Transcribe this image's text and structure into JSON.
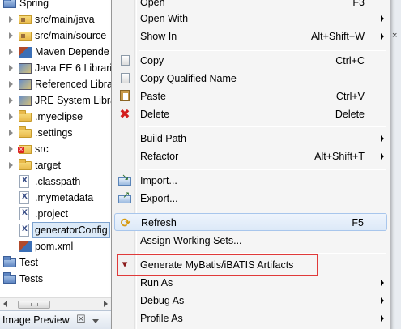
{
  "explorer": {
    "items": [
      {
        "label": "Spring",
        "icon": "project-icon"
      },
      {
        "label": "src/main/java",
        "icon": "package-folder-icon"
      },
      {
        "label": "src/main/source",
        "icon": "package-folder-icon"
      },
      {
        "label": "Maven Depende",
        "icon": "maven-library-icon"
      },
      {
        "label": "Java EE 6 Librari",
        "icon": "library-icon"
      },
      {
        "label": "Referenced Libra",
        "icon": "library-icon"
      },
      {
        "label": "JRE System Libra",
        "icon": "library-icon"
      },
      {
        "label": ".myeclipse",
        "icon": "folder-icon"
      },
      {
        "label": ".settings",
        "icon": "folder-icon"
      },
      {
        "label": "src",
        "icon": "error-folder-icon"
      },
      {
        "label": "target",
        "icon": "folder-icon"
      },
      {
        "label": ".classpath",
        "icon": "xml-file-icon"
      },
      {
        "label": ".mymetadata",
        "icon": "xml-file-icon"
      },
      {
        "label": ".project",
        "icon": "xml-file-icon"
      },
      {
        "label": "generatorConfig",
        "icon": "xml-file-icon",
        "selected": true
      },
      {
        "label": "pom.xml",
        "icon": "maven-pom-icon"
      },
      {
        "label": "Test",
        "icon": "project-icon"
      },
      {
        "label": "Tests",
        "icon": "project-icon"
      }
    ]
  },
  "bottom_tab": {
    "label": "Image Preview",
    "close": "☒"
  },
  "context_menu": {
    "items": [
      {
        "label": "Open",
        "accel": "F3"
      },
      {
        "label": "Open With",
        "submenu": true
      },
      {
        "label": "Show In",
        "accel": "Alt+Shift+W",
        "submenu": true
      },
      {
        "separator": true
      },
      {
        "label": "Copy",
        "accel": "Ctrl+C",
        "icon": "copy-icon"
      },
      {
        "label": "Copy Qualified Name",
        "icon": "copy-qualified-icon"
      },
      {
        "label": "Paste",
        "accel": "Ctrl+V",
        "icon": "paste-icon"
      },
      {
        "label": "Delete",
        "accel": "Delete",
        "icon": "delete-icon"
      },
      {
        "separator": true
      },
      {
        "label": "Build Path",
        "submenu": true
      },
      {
        "label": "Refactor",
        "accel": "Alt+Shift+T",
        "submenu": true
      },
      {
        "separator": true
      },
      {
        "label": "Import...",
        "icon": "import-icon"
      },
      {
        "label": "Export...",
        "icon": "export-icon"
      },
      {
        "separator": true
      },
      {
        "label": "Refresh",
        "accel": "F5",
        "icon": "refresh-icon",
        "hover": true
      },
      {
        "label": "Assign Working Sets..."
      },
      {
        "separator": true
      },
      {
        "label": "Generate MyBatis/iBATIS Artifacts",
        "icon": "mybatis-icon",
        "highlighted": true
      },
      {
        "label": "Run As",
        "submenu": true
      },
      {
        "label": "Debug As",
        "submenu": true
      },
      {
        "label": "Profile As",
        "submenu": true
      }
    ]
  },
  "colors": {
    "menu_bg": "#f5f5f5",
    "hover_bg": "#dce9f8",
    "highlight_box": "#e03a3a",
    "selection_bg": "#dceaf8"
  }
}
